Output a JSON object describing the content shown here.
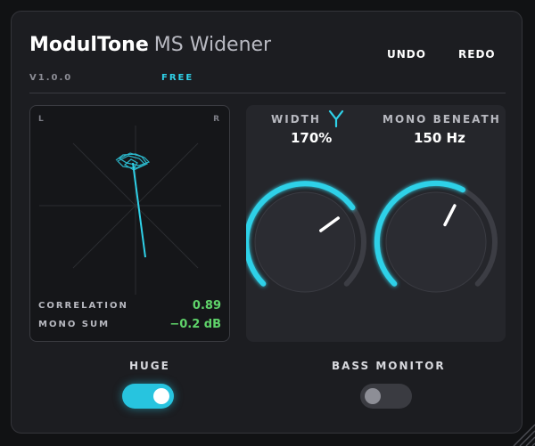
{
  "header": {
    "brand_bold": "ModulTone",
    "brand_light": "MS Widener",
    "version": "V1.0.0",
    "tier": "FREE",
    "undo_label": "UNDO",
    "redo_label": "REDO"
  },
  "scope": {
    "left_label": "L",
    "right_label": "R",
    "correlation_label": "CORRELATION",
    "correlation_value": "0.89",
    "mono_sum_label": "MONO SUM",
    "mono_sum_value": "−0.2 dB"
  },
  "controls": {
    "width": {
      "label": "WIDTH",
      "value": "170%",
      "level": 0.7
    },
    "mono_beneath": {
      "label": "MONO BENEATH",
      "value": "150 Hz",
      "level": 0.6
    }
  },
  "toggles": {
    "huge": {
      "label": "HUGE",
      "on": true
    },
    "bass_monitor": {
      "label": "BASS MONITOR",
      "on": false
    }
  },
  "colors": {
    "accent": "#2fd1e8",
    "meter_green": "#5fd36a",
    "panel": "#1c1d21"
  },
  "icons": {
    "width_mode": "y-shape-icon"
  }
}
